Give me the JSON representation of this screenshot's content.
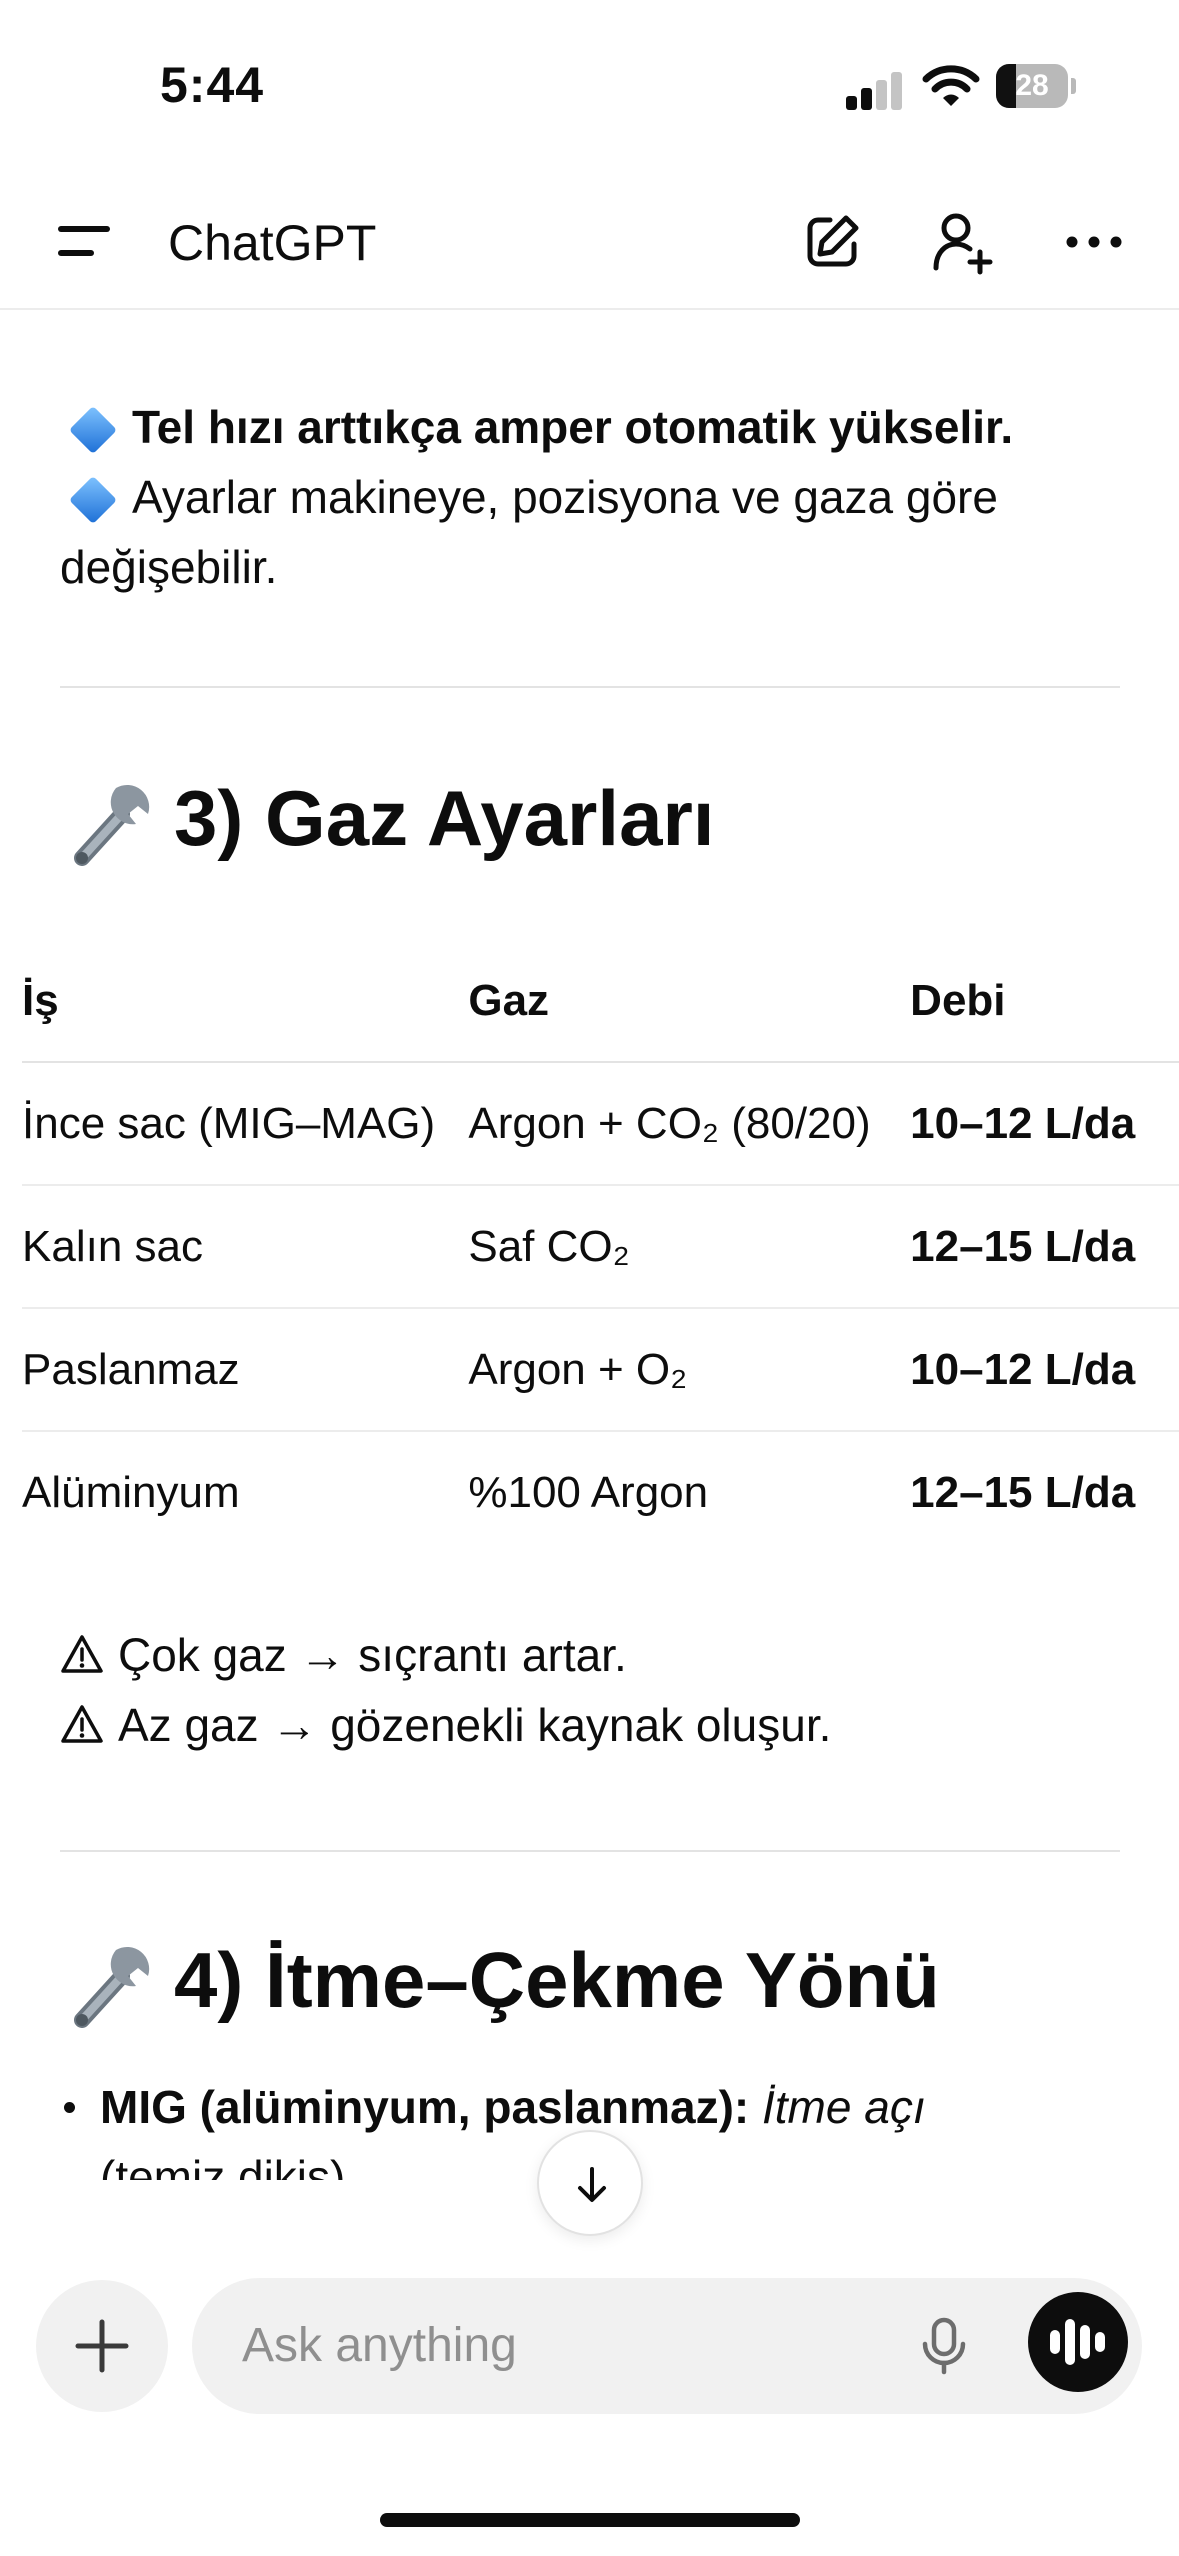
{
  "status_bar": {
    "time": "5:44",
    "battery_level": "28",
    "battery_fraction": 0.28
  },
  "header": {
    "title": "ChatGPT",
    "icons": [
      "menu-icon",
      "new-chat-icon",
      "add-person-icon",
      "more-icon"
    ]
  },
  "intro": {
    "line1_bold": "Tel hızı arttıkça amper otomatik yükselir.",
    "line2_a": "Ayarlar makineye, pozisyona ve gaza göre",
    "line2_b": "değişebilir."
  },
  "section3": {
    "title": "3) Gaz Ayarları",
    "table": {
      "headers": [
        "İş",
        "Gaz",
        "Debi"
      ],
      "rows": [
        [
          "İnce sac (MIG–MAG)",
          "Argon + CO₂ (80/20)",
          "10–12 L/da"
        ],
        [
          "Kalın sac",
          "Saf CO₂",
          "12–15 L/da"
        ],
        [
          "Paslanmaz",
          "Argon + O₂",
          "10–12 L/da"
        ],
        [
          "Alüminyum",
          "%100 Argon",
          "12–15 L/da"
        ]
      ]
    },
    "warnings": [
      "Çok gaz → sıçrantı artar.",
      "Az gaz → gözenekli kaynak oluşur."
    ]
  },
  "section4": {
    "title": "4) İtme–Çekme Yönü",
    "bullet": {
      "bold": "MIG (alüminyum, paslanmaz):",
      "italic": "İtme açı",
      "rest": "(temiz dikiş)"
    }
  },
  "composer": {
    "placeholder": "Ask anything"
  },
  "colors": {
    "accent": "#0d0d0d",
    "divider": "#e3e3e3",
    "input_bg": "#f1f1f1",
    "diamond": "#1d6fd6"
  }
}
